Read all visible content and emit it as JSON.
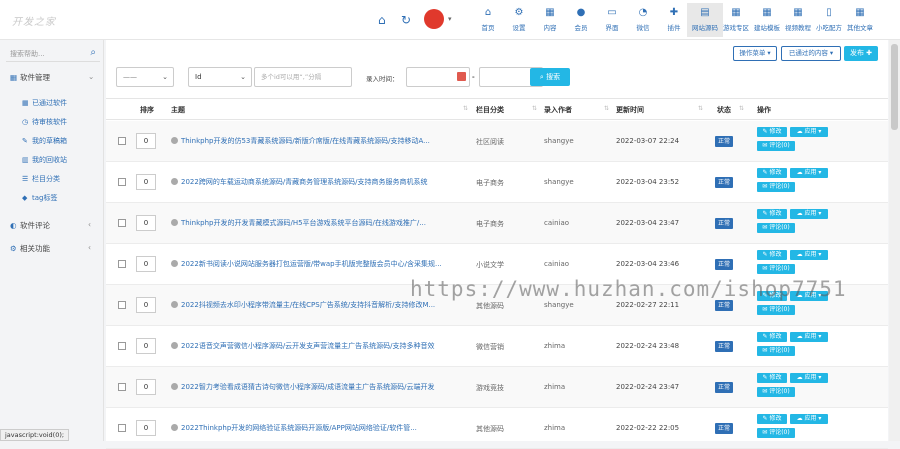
{
  "topbar": {
    "brand": "开发之家",
    "nav": [
      {
        "label": "首页",
        "icon": "home-icon",
        "glyph": "⌂"
      },
      {
        "label": "设置",
        "icon": "gear-icon",
        "glyph": "⚙"
      },
      {
        "label": "内容",
        "icon": "grid-icon",
        "glyph": "▦"
      },
      {
        "label": "会员",
        "icon": "user-icon",
        "glyph": "●"
      },
      {
        "label": "界面",
        "icon": "monitor-icon",
        "glyph": "▭"
      },
      {
        "label": "微信",
        "icon": "wechat-icon",
        "glyph": "◔"
      },
      {
        "label": "插件",
        "icon": "puzzle-icon",
        "glyph": "✚"
      },
      {
        "label": "网站源码",
        "icon": "code-icon",
        "glyph": "▤"
      },
      {
        "label": "游戏专区",
        "icon": "game-icon",
        "glyph": "▦"
      },
      {
        "label": "建站模板",
        "icon": "template-icon",
        "glyph": "▦"
      },
      {
        "label": "视频教程",
        "icon": "video-icon",
        "glyph": "▦"
      },
      {
        "label": "小吃配方",
        "icon": "document-icon",
        "glyph": "▯"
      },
      {
        "label": "其他文章",
        "icon": "article-icon",
        "glyph": "▦"
      }
    ],
    "active_nav_index": 7
  },
  "sidebar": {
    "search_placeholder": "搜索帮助...",
    "menu": [
      {
        "label": "软件管理",
        "icon": "grid-icon",
        "glyph": "▦",
        "expanded": true
      },
      {
        "label": "软件评论",
        "icon": "comment-icon",
        "glyph": "◐",
        "expanded": false
      },
      {
        "label": "相关功能",
        "icon": "gear-icon",
        "glyph": "⚙",
        "expanded": false
      }
    ],
    "submenu": [
      {
        "label": "已通过软件",
        "icon": "grid-icon",
        "glyph": "▦"
      },
      {
        "label": "待审核软件",
        "icon": "pending-icon",
        "glyph": "◷"
      },
      {
        "label": "我的草稿箱",
        "icon": "drafts-icon",
        "glyph": "✎"
      },
      {
        "label": "我的回收站",
        "icon": "trash-icon",
        "glyph": "▥"
      },
      {
        "label": "栏目分类",
        "icon": "list-icon",
        "glyph": "☰"
      },
      {
        "label": "tag标签",
        "icon": "tag-icon",
        "glyph": "◆"
      }
    ]
  },
  "toolbar": {
    "ops_label": "操作菜单",
    "approved_label": "已通过的内容",
    "publish_label": "发布",
    "filter_empty": "——",
    "field_select": "Id",
    "ids_placeholder": "多个id可以用“,”分隔",
    "date_label": "录入时间：",
    "search_label": "搜索"
  },
  "table": {
    "headers": {
      "order": "排序",
      "title": "主题",
      "category": "栏目分类",
      "author": "录入作者",
      "updated": "更新时间",
      "status": "状态",
      "actions": "操作"
    },
    "actions": {
      "edit": "修改",
      "apply": "应用",
      "comment": "评论(0)"
    },
    "rows": [
      {
        "order": "0",
        "title": "Thinkphp开发的仿53青藏系统源码/新版介席版/在线青藏系统源码/支持移动A...",
        "category": "社区阅读",
        "author": "shangye",
        "date": "2022-03-07 22:24",
        "status": "正常"
      },
      {
        "order": "0",
        "title": "2022跨网的车载运动商系统源码/青藏商务管理系统源码/支持商务服务商机系统",
        "category": "电子商务",
        "author": "shangye",
        "date": "2022-03-04 23:52",
        "status": "正常"
      },
      {
        "order": "0",
        "title": "Thinkphp开发的开发青藏模式源码/H5平台游戏系统平台源码/在线游戏推广/...",
        "category": "电子商务",
        "author": "cainiao",
        "date": "2022-03-04 23:47",
        "status": "正常"
      },
      {
        "order": "0",
        "title": "2022新书阅读小说网站服务器打包运营版/带wap手机版完整版会员中心/含采集规...",
        "category": "小说文学",
        "author": "cainiao",
        "date": "2022-03-04 23:46",
        "status": "正常"
      },
      {
        "order": "0",
        "title": "2022抖视频去水印小程序带流量主/在线CPS广告系统/支持抖音解析/支持修改M...",
        "category": "其他源码",
        "author": "shangye",
        "date": "2022-02-27 22:11",
        "status": "正常"
      },
      {
        "order": "0",
        "title": "2022语音交声营微信小程序源码/云开发支声营流量主广告系统源码/支持多种音效",
        "category": "微信营销",
        "author": "zhima",
        "date": "2022-02-24 23:48",
        "status": "正常"
      },
      {
        "order": "0",
        "title": "2022智力考验看成语猜古诗句微信小程序源码/成语流量主广告系统源码/云端开发",
        "category": "游戏竞技",
        "author": "zhima",
        "date": "2022-02-24 23:47",
        "status": "正常"
      },
      {
        "order": "0",
        "title": "2022Thinkphp开发的网络验证系统源码开源版/APP网站网络验证/软件管...",
        "category": "其他源码",
        "author": "zhima",
        "date": "2022-02-22 22:05",
        "status": "正常"
      }
    ]
  },
  "watermark": "https://www.huzhan.com/ishop7751",
  "statusbar": "javascript:void(0);",
  "colors": {
    "accent": "#2f6fb5",
    "button": "#23b7e5",
    "logo": "#e0392c"
  }
}
